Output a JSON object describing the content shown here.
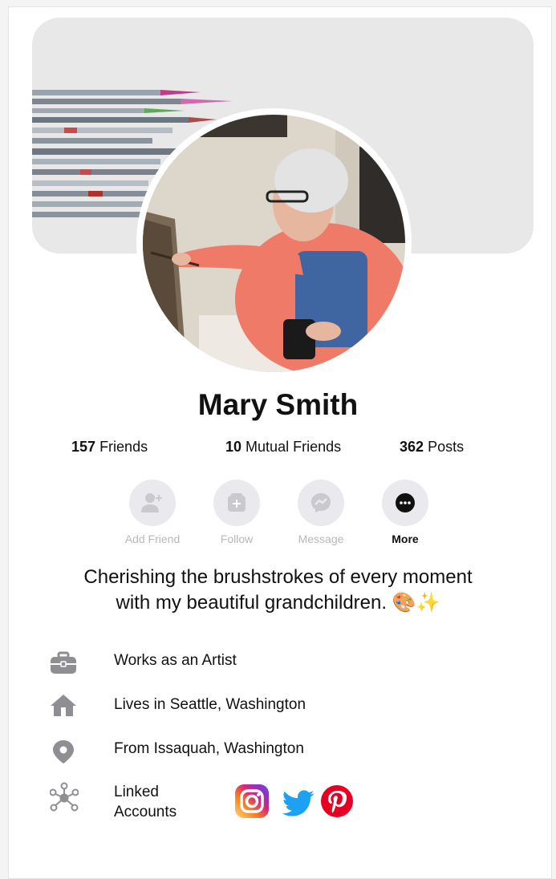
{
  "profile": {
    "name": "Mary Smith",
    "bio_line1": "Cherishing the brushstrokes of every moment",
    "bio_line2": "with my beautiful grandchildren. 🎨✨"
  },
  "stats": [
    {
      "value": "157",
      "label": "Friends"
    },
    {
      "value": "10",
      "label": "Mutual Friends"
    },
    {
      "value": "362",
      "label": "Posts"
    }
  ],
  "actions": [
    {
      "label": "Add Friend",
      "icon": "add-friend-icon"
    },
    {
      "label": "Follow",
      "icon": "follow-icon"
    },
    {
      "label": "Message",
      "icon": "messenger-icon"
    },
    {
      "label": "More",
      "icon": "more-icon"
    }
  ],
  "about": [
    {
      "icon": "briefcase-icon",
      "text": "Works as an Artist"
    },
    {
      "icon": "home-icon",
      "text": "Lives in Seattle, Washington"
    },
    {
      "icon": "location-pin-icon",
      "text": "From Issaquah, Washington"
    },
    {
      "icon": "network-icon",
      "text_line1": "Linked",
      "text_line2": "Accounts"
    }
  ],
  "linked_accounts": [
    "instagram",
    "twitter",
    "pinterest"
  ],
  "colors": {
    "card": "#ffffff",
    "cover": "#e8e8e8",
    "action_bg": "#e9e9ee",
    "action_disabled": "#b8b8bd",
    "icon_gray": "#8e8e93",
    "twitter": "#1da1f2",
    "pinterest": "#e60023"
  }
}
